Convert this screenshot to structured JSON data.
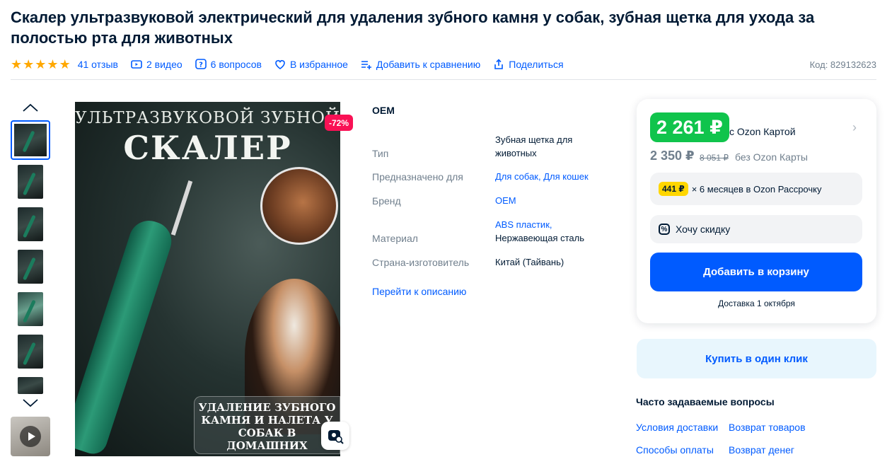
{
  "product": {
    "title": "Скалер ультразвуковой электрический для удаления зубного камня у собак, зубная щетка для ухода за полостью рта для животных",
    "reviews": "41 отзыв",
    "videos": "2 видео",
    "questions": "6 вопросов",
    "favorites": "В избранное",
    "compare": "Добавить к сравнению",
    "share": "Поделиться",
    "code": "Код: 829132623",
    "rating": 5
  },
  "gallery": {
    "discount_badge": "-72%",
    "image_text_top": "УЛЬТРАЗВУКОВОЙ ЗУБНОЙ",
    "image_text_big": "СКАЛЕР",
    "image_text_bottom": "УДАЛЕНИЕ ЗУБНОГО\nКАМНЯ И НАЛЕТА У\nСОБАК В ДОМАШНИХ\nУСЛОВИЯХ"
  },
  "specs": {
    "brand": "OEM",
    "rows": [
      {
        "key": "Тип",
        "value": "Зубная щетка для животных"
      },
      {
        "key": "Предназначено для",
        "value": "Для собак, Для кошек"
      },
      {
        "key": "Бренд",
        "value": "OEM"
      },
      {
        "key": "Материал",
        "value_link": "ABS пластик,",
        "value_text": "Нержавеющая сталь"
      },
      {
        "key": "Страна-изготовитель",
        "value": "Китай (Тайвань)"
      }
    ],
    "description_link": "Перейти к описанию"
  },
  "price": {
    "ozon_price": "2 261 ₽",
    "ozon_card_label": "с Ozon Картой",
    "regular_price": "2 350 ₽",
    "old_price": "8 051 ₽",
    "without_card": "без Ozon Карты",
    "installment_amount": "441 ₽",
    "installment_text": "× 6 месяцев в Ozon Рассрочку",
    "want_discount": "Хочу скидку",
    "add_to_cart": "Добавить в корзину",
    "delivery": "Доставка 1 октября",
    "buy_one_click": "Купить в один клик",
    "colors": {
      "green": "#10c44c",
      "blue": "#005bff",
      "badge": "#f91155"
    }
  },
  "faq": {
    "title": "Часто задаваемые вопросы",
    "links": [
      "Условия доставки",
      "Возврат товаров",
      "Способы оплаты",
      "Возврат денег"
    ]
  }
}
